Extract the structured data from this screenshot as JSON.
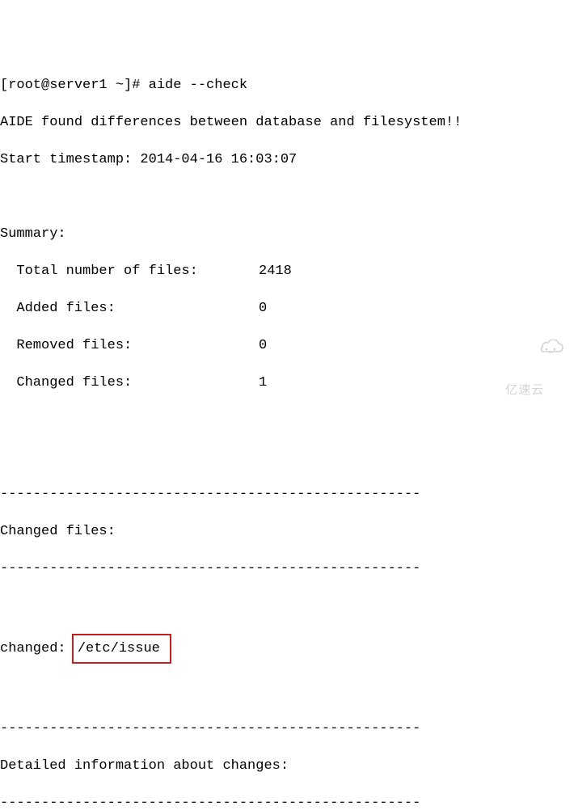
{
  "prompt": "[root@server1 ~]# ",
  "command": "aide --check",
  "output": {
    "msg": "AIDE found differences between database and filesystem!!",
    "timestamp_line": "Start timestamp: 2014-04-16 16:03:07",
    "summary_heading": "Summary:",
    "summary": {
      "total_label": "  Total number of files:",
      "total_value": "2418",
      "added_label": "  Added files:",
      "added_value": "0",
      "removed_label": "  Removed files:",
      "removed_value": "0",
      "changed_label": "  Changed files:",
      "changed_value": "1"
    },
    "divider": "---------------------------------------------------",
    "changed_heading": "Changed files:",
    "changed_entry_label": "changed: ",
    "changed_entry_value": "/etc/issue",
    "details_heading": "Detailed information about changes:"
  },
  "watermark": "亿速云"
}
